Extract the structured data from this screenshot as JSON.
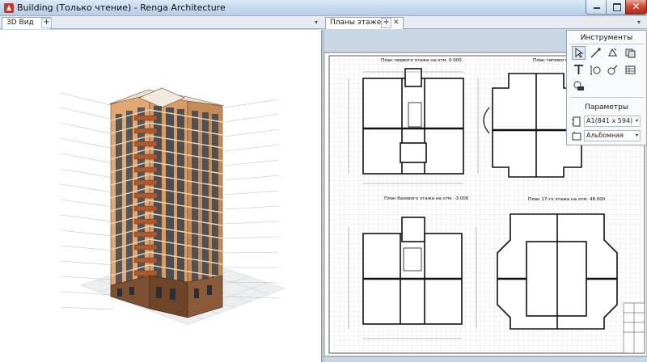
{
  "window": {
    "title": "Building (Только чтение) - Renga Architecture",
    "close_glyph": "✕"
  },
  "tabs_left": [
    {
      "label": "3D Вид",
      "close": "✕"
    }
  ],
  "tabs_right": [
    {
      "label": "Планы этажей",
      "close": "✕"
    }
  ],
  "tab_add_glyph": "+",
  "tab_menu_glyph": "▾",
  "plans": {
    "plan1_title": "План первого этажа на отм. 0.000",
    "plan2_title": "План типового этажа на отм.",
    "plan3_title": "План 17-го этажа на отм. 48.000",
    "plan4_title": "План базового этажа на отм. -3.000"
  },
  "instruments": {
    "title": "Инструменты",
    "tools": [
      {
        "icon": "select-arrow-icon"
      },
      {
        "icon": "line-icon"
      },
      {
        "icon": "rotate-icon"
      },
      {
        "icon": "layers-icon"
      },
      {
        "icon": "text-icon"
      },
      {
        "icon": "axis-icon"
      },
      {
        "icon": "node-icon"
      },
      {
        "icon": "table-icon"
      },
      {
        "icon": "annotation-icon"
      }
    ]
  },
  "parameters": {
    "title": "Параметры",
    "sheet_format": "А1(841 x 594)",
    "orientation": "Альбомная"
  },
  "colors": {
    "titlebar": "#c4d7ec",
    "close": "#c8472f",
    "plan_bg": "#c9d6e4",
    "facade": "#e8b98a",
    "balcony": "#b05a2c",
    "base": "#8a5a3a"
  }
}
